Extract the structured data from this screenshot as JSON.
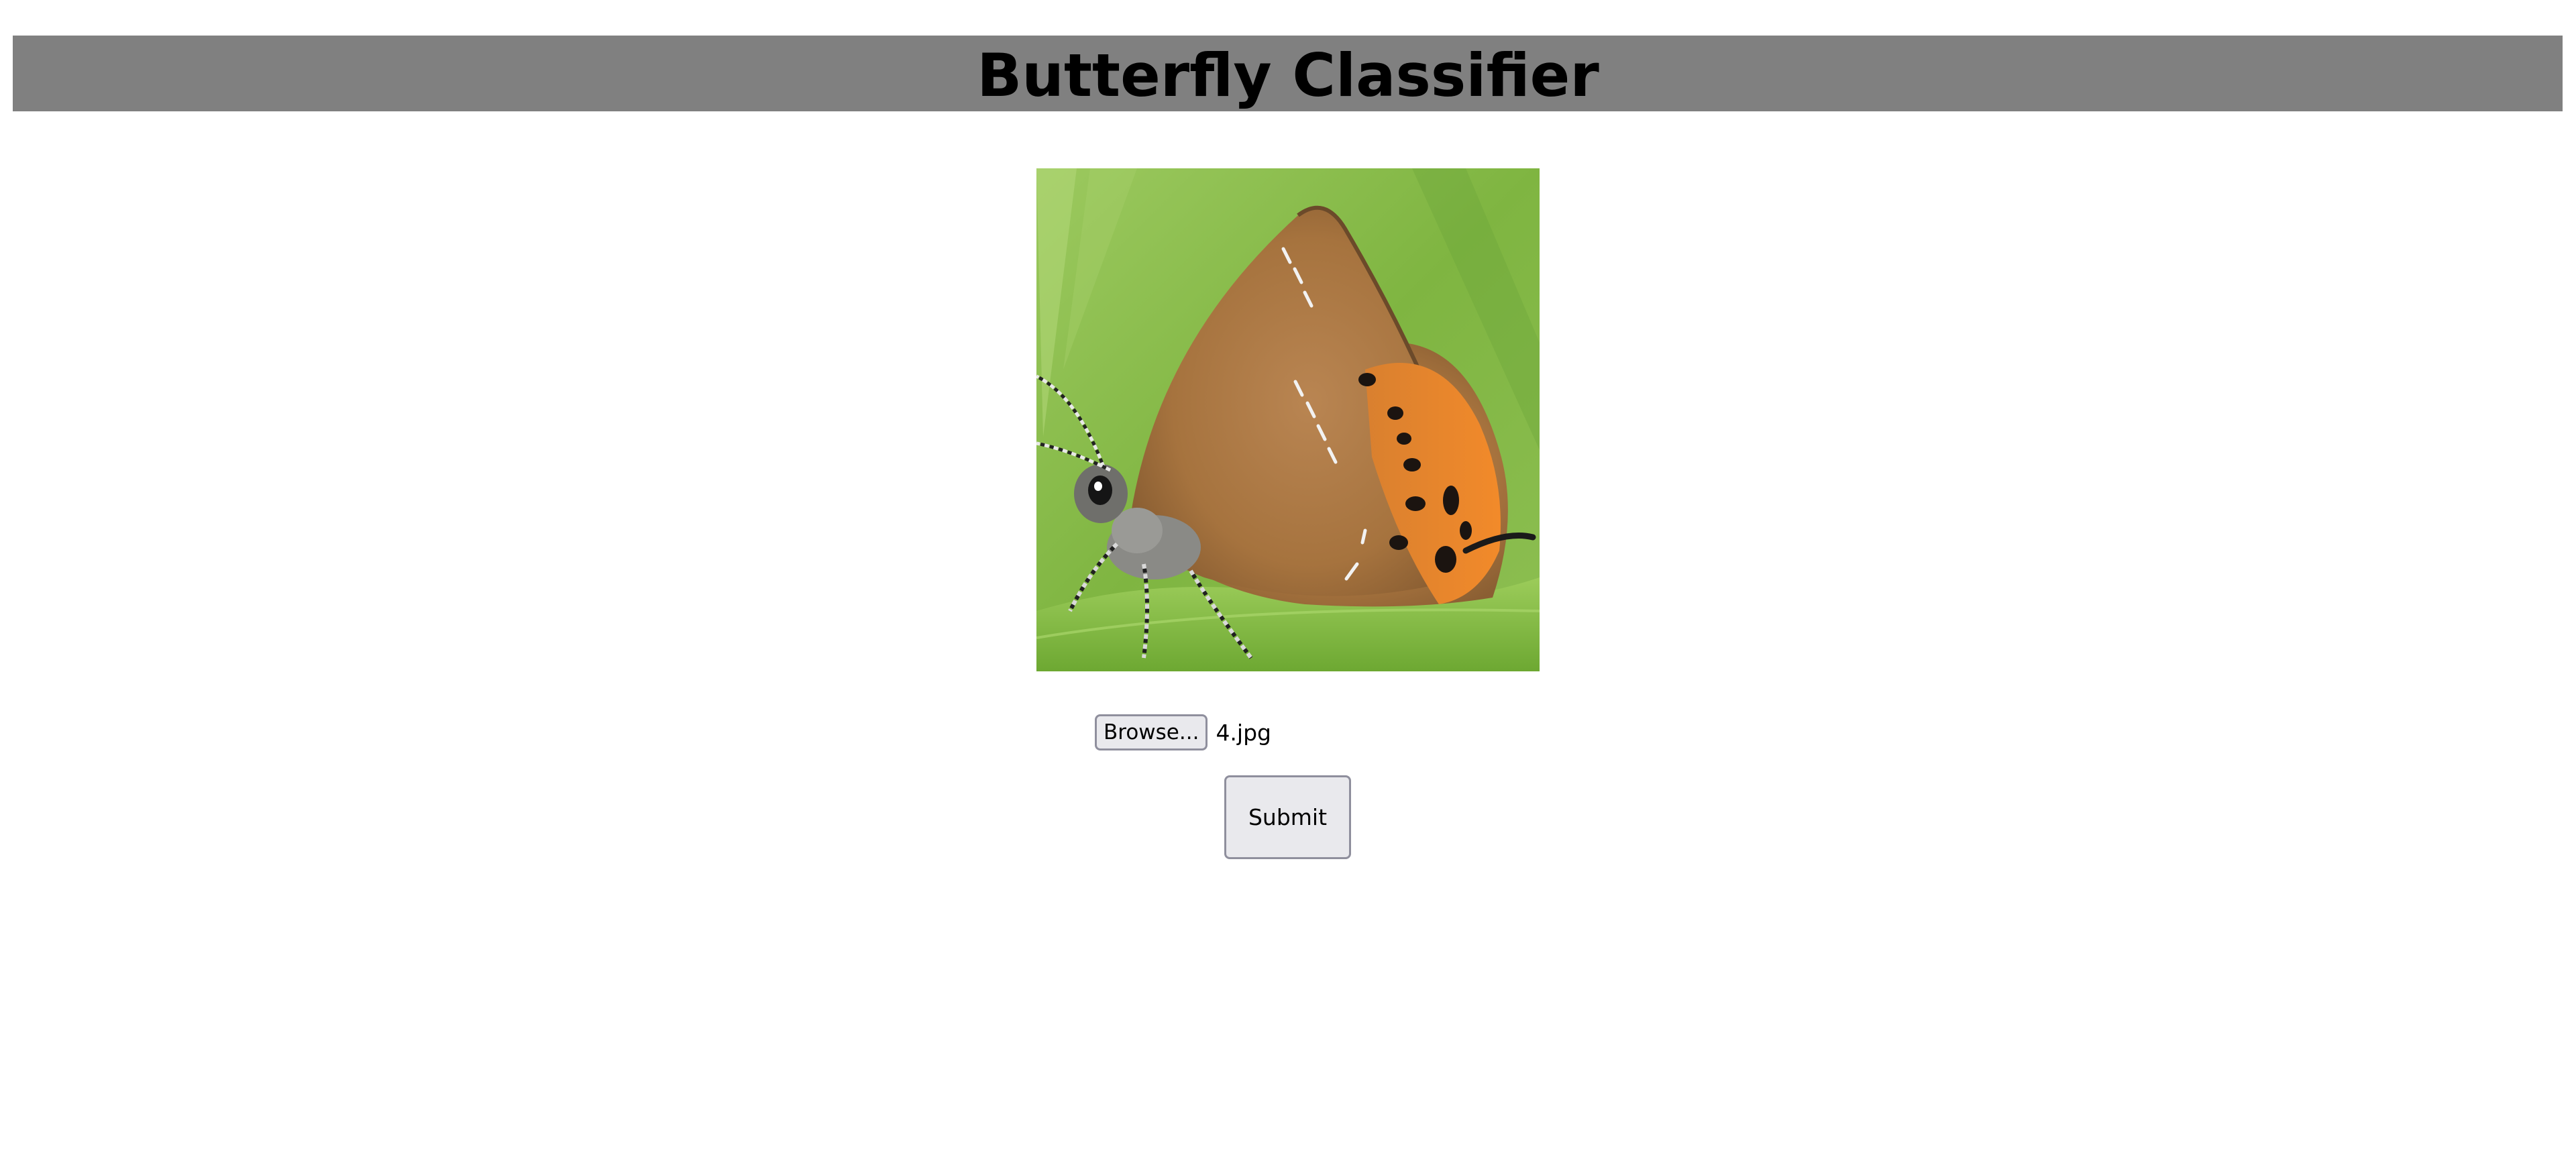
{
  "header": {
    "title": "Butterfly Classifier",
    "background_color": "#808080"
  },
  "preview": {
    "image": "butterfly-photo"
  },
  "upload": {
    "browse_label": "Browse...",
    "file_name": "4.jpg"
  },
  "form": {
    "submit_label": "Submit"
  },
  "colors": {
    "button_background": "#e9e9ed",
    "button_border": "#8f8f9d"
  }
}
